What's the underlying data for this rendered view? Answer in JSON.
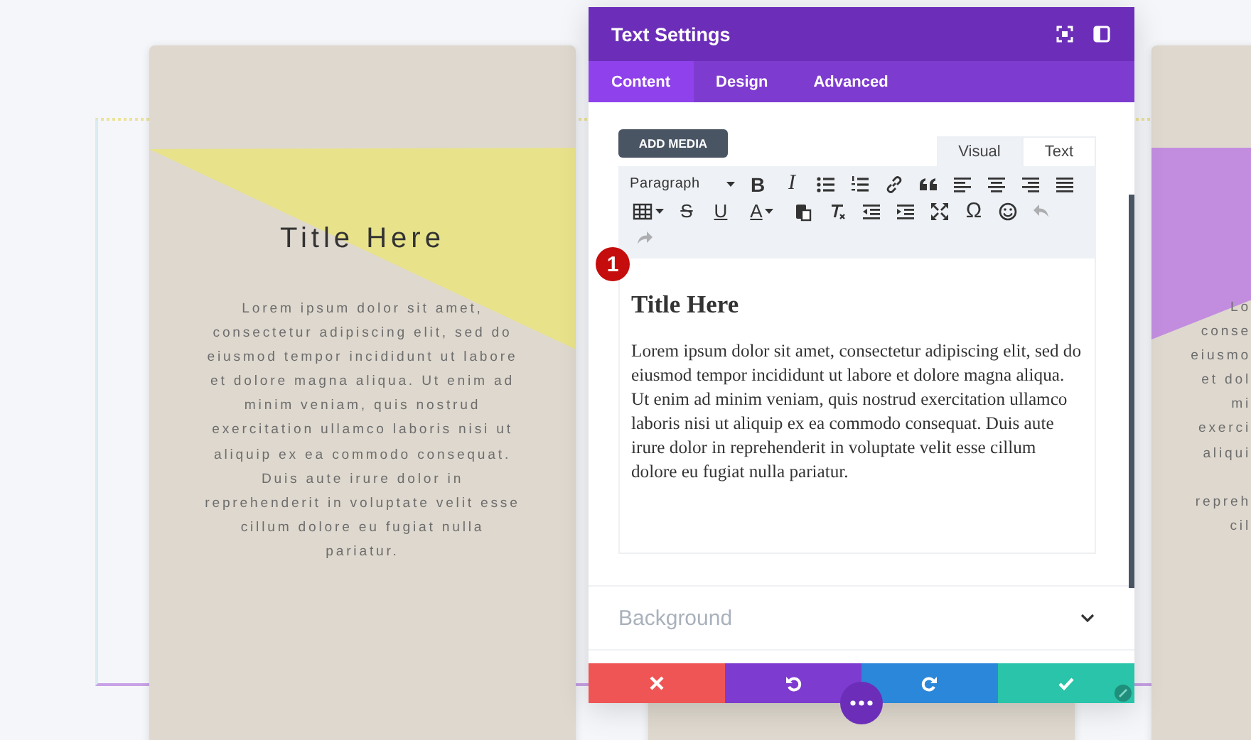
{
  "canvas": {
    "cards": [
      {
        "kind": "full",
        "color": "#e8e38a",
        "title": "Title Here",
        "lines": [
          "Lorem ipsum dolor sit amet,",
          "consectetur adipiscing elit, sed do",
          "eiusmod tempor incididunt ut labore",
          "et dolore magna aliqua. Ut enim ad",
          "minim veniam, quis nostrud",
          "exercitation ullamco laboris nisi ut",
          "aliquip ex ea commodo consequat.",
          "Duis aute irure dolor in",
          "reprehenderit in voluptate velit esse",
          "cillum dolore eu fugiat nulla",
          "pariatur."
        ]
      },
      {
        "kind": "plain"
      },
      {
        "kind": "clipped",
        "color": "#c28ddf",
        "blocks": [
          [
            "Lo",
            "conse",
            "eiusmo",
            "et dol",
            "mi",
            "exerci",
            "aliqui"
          ],
          [
            "repreh",
            "cil"
          ]
        ]
      }
    ]
  },
  "panel": {
    "title": "Text Settings",
    "tabs": [
      {
        "label": "Content",
        "selected": true
      },
      {
        "label": "Design",
        "selected": false
      },
      {
        "label": "Advanced",
        "selected": false
      }
    ],
    "add_media": "ADD MEDIA",
    "editor_tabs": [
      {
        "label": "Visual",
        "selected": true
      },
      {
        "label": "Text",
        "selected": false
      }
    ],
    "toolbar": [
      {
        "kind": "select",
        "label": "Paragraph",
        "disabled": false
      },
      {
        "kind": "bold",
        "label": "B",
        "disabled": false
      },
      {
        "kind": "italic",
        "label": "I",
        "disabled": false
      },
      {
        "kind": "bullets",
        "disabled": false
      },
      {
        "kind": "numbers",
        "disabled": false
      },
      {
        "kind": "link",
        "disabled": false
      },
      {
        "kind": "quote",
        "disabled": false
      },
      {
        "kind": "align-left",
        "disabled": false
      },
      {
        "kind": "align-center",
        "disabled": false
      },
      {
        "kind": "align-right",
        "disabled": false
      },
      {
        "kind": "justify",
        "disabled": false
      },
      {
        "kind": "table",
        "disabled": false
      },
      {
        "kind": "strike",
        "label": "S",
        "disabled": false
      },
      {
        "kind": "underline",
        "label": "U",
        "disabled": false
      },
      {
        "kind": "color",
        "label": "A",
        "disabled": false
      },
      {
        "kind": "paste",
        "disabled": false
      },
      {
        "kind": "clear",
        "disabled": false
      },
      {
        "kind": "outdent",
        "disabled": false
      },
      {
        "kind": "indent",
        "disabled": false
      },
      {
        "kind": "fullscreen",
        "disabled": false
      },
      {
        "kind": "symbol",
        "label": "Ω",
        "disabled": false
      },
      {
        "kind": "emoji",
        "disabled": false
      },
      {
        "kind": "undo",
        "disabled": true
      },
      {
        "kind": "redo",
        "disabled": true
      }
    ],
    "badge": "1",
    "editor": {
      "heading": "Title Here",
      "paragraph": "Lorem ipsum dolor sit amet, consectetur adipiscing elit, sed do eiusmod tempor incididunt ut labore et dolore magna aliqua. Ut enim ad minim veniam, quis nostrud exercitation ullamco laboris nisi ut aliquip ex ea commodo consequat. Duis aute irure dolor in reprehenderit in voluptate velit esse cillum dolore eu fugiat nulla pariatur."
    },
    "sections": [
      {
        "label": "Background",
        "expanded": false
      }
    ],
    "footer": [
      {
        "kind": "cancel"
      },
      {
        "kind": "undo"
      },
      {
        "kind": "redo"
      },
      {
        "kind": "save"
      }
    ]
  }
}
